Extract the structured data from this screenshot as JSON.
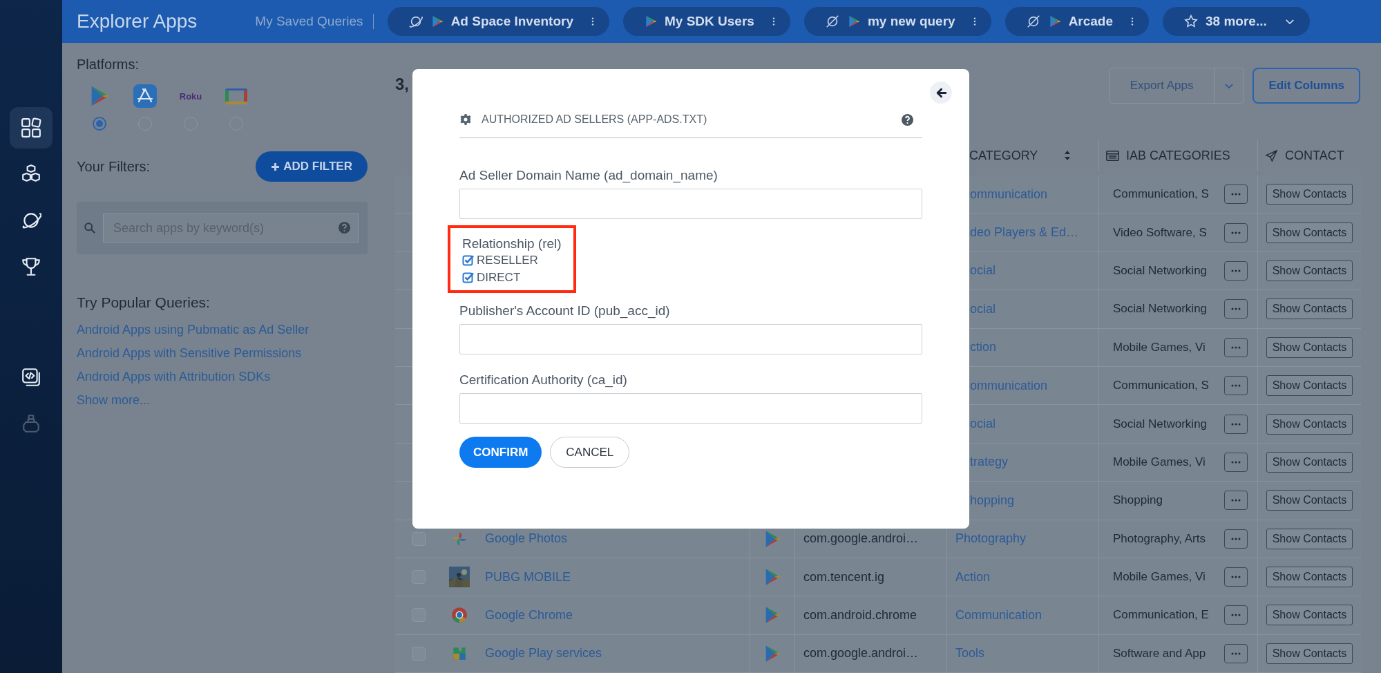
{
  "rail": {
    "top": [
      {
        "kind": "grid",
        "selected": true
      },
      {
        "kind": "cubes",
        "selected": false
      },
      {
        "kind": "planet",
        "selected": false
      },
      {
        "kind": "trophy",
        "selected": false
      }
    ],
    "bottom": [
      {
        "kind": "code",
        "selected": false,
        "disabled": false
      },
      {
        "kind": "robot",
        "selected": false,
        "disabled": true
      }
    ]
  },
  "header": {
    "title": "Explorer Apps",
    "saved_label": "My Saved Queries",
    "saved_queries": [
      {
        "kind": "planet",
        "label": "Ad Space Inventory"
      },
      {
        "kind": "plain",
        "label": "My SDK Users"
      },
      {
        "kind": "crossed",
        "label": "my new query"
      },
      {
        "kind": "crossed",
        "label": "Arcade"
      }
    ],
    "more": "38 more..."
  },
  "sidebar": {
    "platforms_label": "Platforms:",
    "platforms": [
      {
        "kind": "google-play",
        "selected": true
      },
      {
        "kind": "app-store",
        "selected": false
      },
      {
        "kind": "roku",
        "label": "Roku",
        "selected": false
      },
      {
        "kind": "tv",
        "selected": false
      }
    ],
    "filters_label": "Your Filters:",
    "add_filter": "ADD FILTER",
    "search": {
      "placeholder": "Search apps by keyword(s)"
    },
    "popular_title": "Try Popular Queries:",
    "popular_links": [
      "Android Apps using Pubmatic as Ad Seller",
      "Android Apps with Sensitive Permissions",
      "Android Apps with Attribution SDKs"
    ],
    "show_more": "Show more..."
  },
  "results": {
    "count": "3,",
    "export": {
      "label": "Export Apps",
      "disabled": true
    },
    "edit_columns": "Edit Columns"
  },
  "table": {
    "columns": [
      {
        "label": "CATEGORY",
        "kind": "sort"
      },
      {
        "label": "IAB CATEGORIES",
        "kind": "list"
      },
      {
        "label": "CONTACT",
        "kind": "plane"
      }
    ],
    "rows": [
      {
        "category": "ommunication",
        "iab": "Communication, S",
        "contact": "Show Contacts"
      },
      {
        "category": "deo Players & Ed…",
        "iab": "Video Software, S",
        "contact": "Show Contacts"
      },
      {
        "category": "ocial",
        "iab": "Social Networking",
        "contact": "Show Contacts"
      },
      {
        "category": "ocial",
        "iab": "Social Networking",
        "contact": "Show Contacts"
      },
      {
        "category": "ction",
        "iab": "Mobile Games, Vi",
        "contact": "Show Contacts"
      },
      {
        "category": "ommunication",
        "iab": "Communication, S",
        "contact": "Show Contacts"
      },
      {
        "category": "ocial",
        "iab": "Social Networking",
        "contact": "Show Contacts"
      },
      {
        "category": "trategy",
        "iab": "Mobile Games, Vi",
        "contact": "Show Contacts"
      },
      {
        "category": "hopping",
        "iab": "Shopping",
        "contact": "Show Contacts"
      },
      {
        "checked": false,
        "kind": "pinwheel",
        "name": "Google Photos",
        "package": "com.google.androi…",
        "category": "Photography",
        "iab": "Photography, Arts",
        "contact": "Show Contacts"
      },
      {
        "checked": false,
        "kind": "picture",
        "name": "PUBG MOBILE",
        "package": "com.tencent.ig",
        "category": "Action",
        "iab": "Mobile Games, Vi",
        "contact": "Show Contacts"
      },
      {
        "checked": false,
        "kind": "ring",
        "name": "Google Chrome",
        "package": "com.android.chrome",
        "category": "Communication",
        "iab": "Communication, E",
        "contact": "Show Contacts"
      },
      {
        "checked": false,
        "kind": "puzzle",
        "name": "Google Play services",
        "package": "com.google.androi…",
        "category": "Tools",
        "iab": "Software and App",
        "contact": "Show Contacts"
      }
    ]
  },
  "modal": {
    "title": "AUTHORIZED AD SELLERS (APP-ADS.TXT)",
    "fields": [
      {
        "kind": "input",
        "label": "Ad Seller Domain Name (ad_domain_name)"
      },
      {
        "kind": "checkboxes",
        "label": "Relationship (rel)",
        "highlighted": true,
        "options": [
          {
            "label": "RESELLER",
            "checked": true
          },
          {
            "label": "DIRECT",
            "checked": true
          }
        ]
      },
      {
        "kind": "input",
        "label": "Publisher's Account ID (pub_acc_id)"
      },
      {
        "kind": "input",
        "label": "Certification Authority (ca_id)"
      }
    ],
    "buttons": [
      {
        "kind": "primary",
        "label": "CONFIRM"
      },
      {
        "kind": "secondary",
        "label": "CANCEL"
      }
    ]
  }
}
